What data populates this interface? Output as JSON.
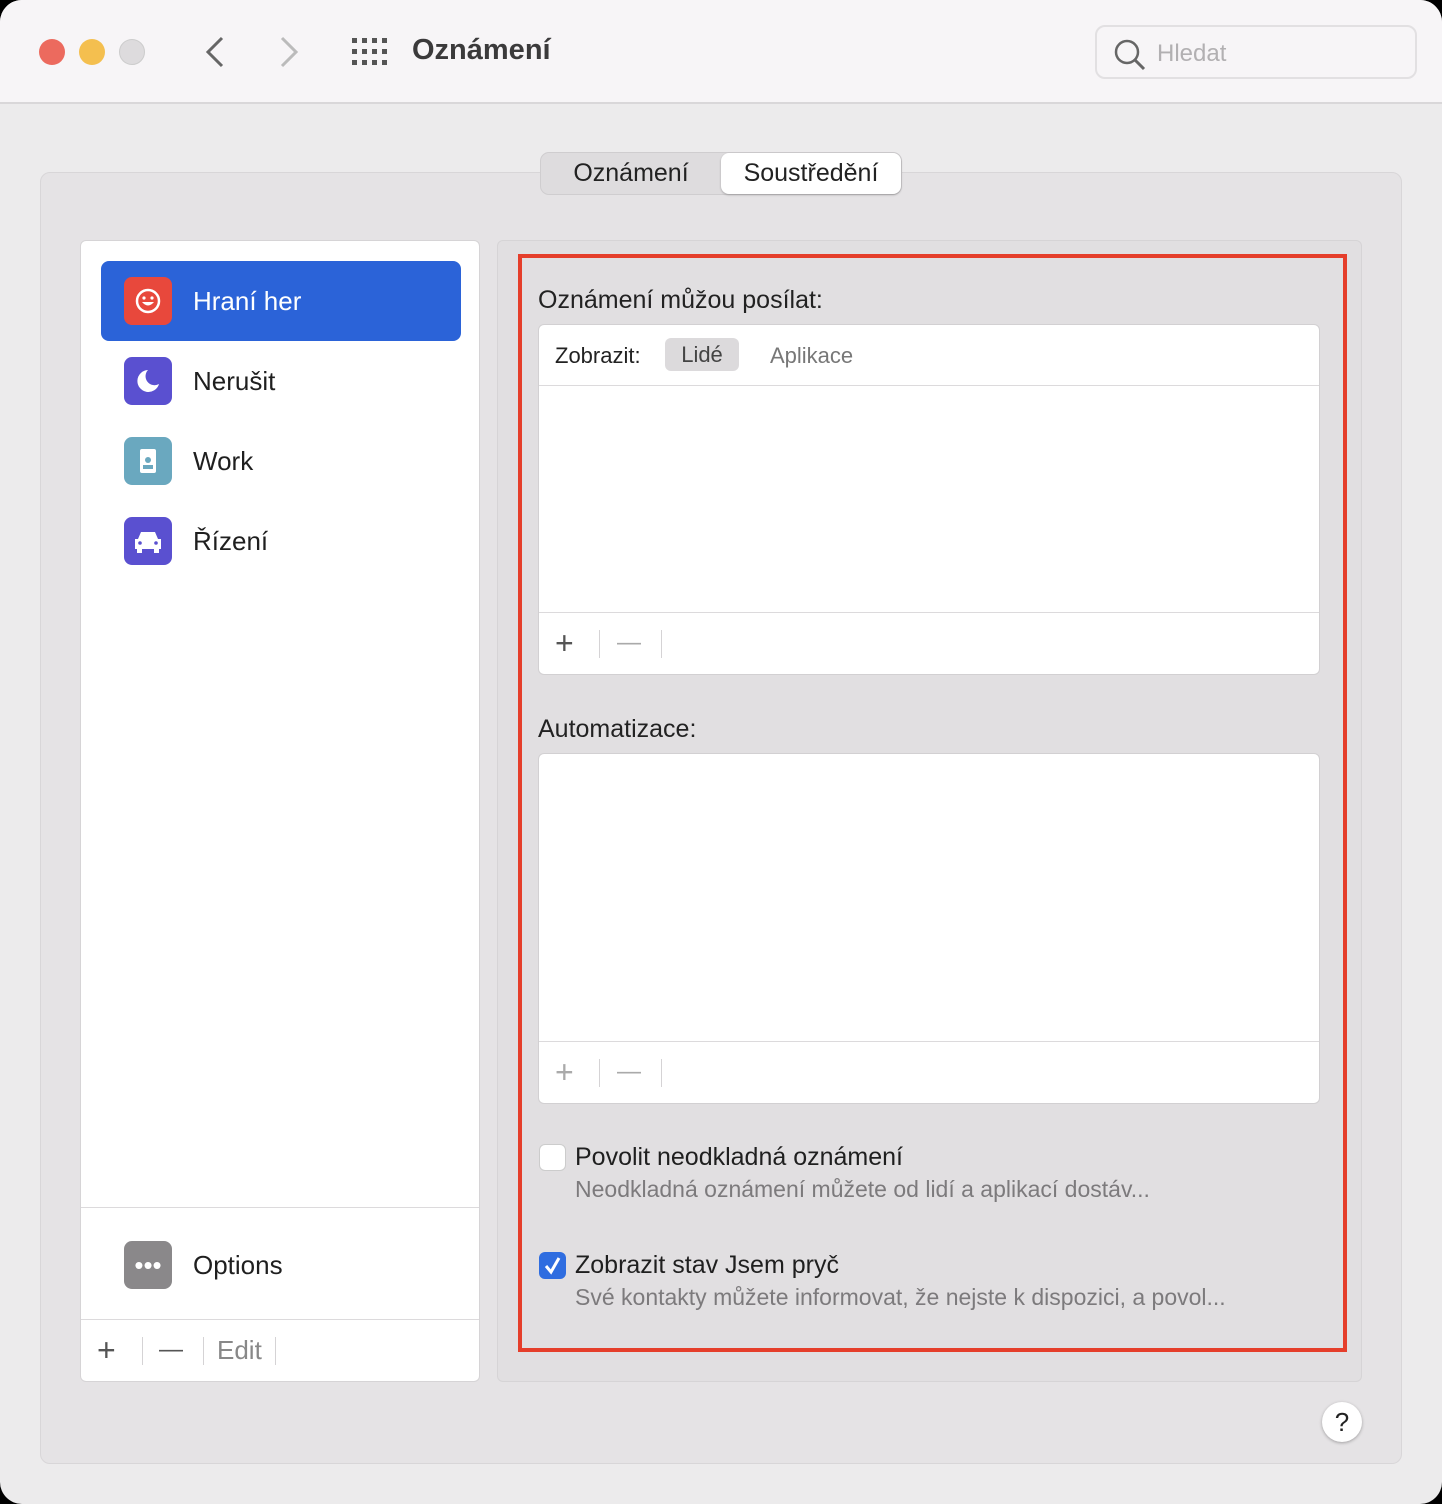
{
  "window": {
    "title": "Oznámení",
    "search_placeholder": "Hledat"
  },
  "tabs": [
    {
      "label": "Oznámení",
      "selected": false
    },
    {
      "label": "Soustředění",
      "selected": true
    }
  ],
  "focus_modes": [
    {
      "label": "Hraní her",
      "icon": "gamepad-smiley-icon",
      "color": "#e8483c",
      "selected": true
    },
    {
      "label": "Nerušit",
      "icon": "moon-icon",
      "color": "#5a50d0",
      "selected": false
    },
    {
      "label": "Work",
      "icon": "id-badge-icon",
      "color": "#6aa8bf",
      "selected": false
    },
    {
      "label": "Řízení",
      "icon": "car-icon",
      "color": "#5a50d0",
      "selected": false
    }
  ],
  "options": {
    "label": "Options",
    "icon": "ellipsis-icon"
  },
  "list_footer": {
    "add": "+",
    "remove": "—",
    "edit": "Edit"
  },
  "allowed": {
    "heading": "Oznámení můžou posílat:",
    "show_label": "Zobrazit:",
    "segments": [
      "Lidé",
      "Aplikace"
    ],
    "selected_segment": "Lidé",
    "add": "+",
    "remove": "—"
  },
  "automation": {
    "heading": "Automatizace:",
    "add": "+",
    "remove": "—"
  },
  "checkboxes": [
    {
      "label": "Povolit neodkladná oznámení",
      "description": "Neodkladná oznámení můžete od lidí a aplikací dostáv...",
      "checked": false
    },
    {
      "label": "Zobrazit stav Jsem pryč",
      "description": "Své kontakty můžete informovat, že nejste k dispozici, a povol...",
      "checked": true
    }
  ],
  "help": "?",
  "colors": {
    "accent": "#2b63d8",
    "highlight": "#e53e2b"
  }
}
